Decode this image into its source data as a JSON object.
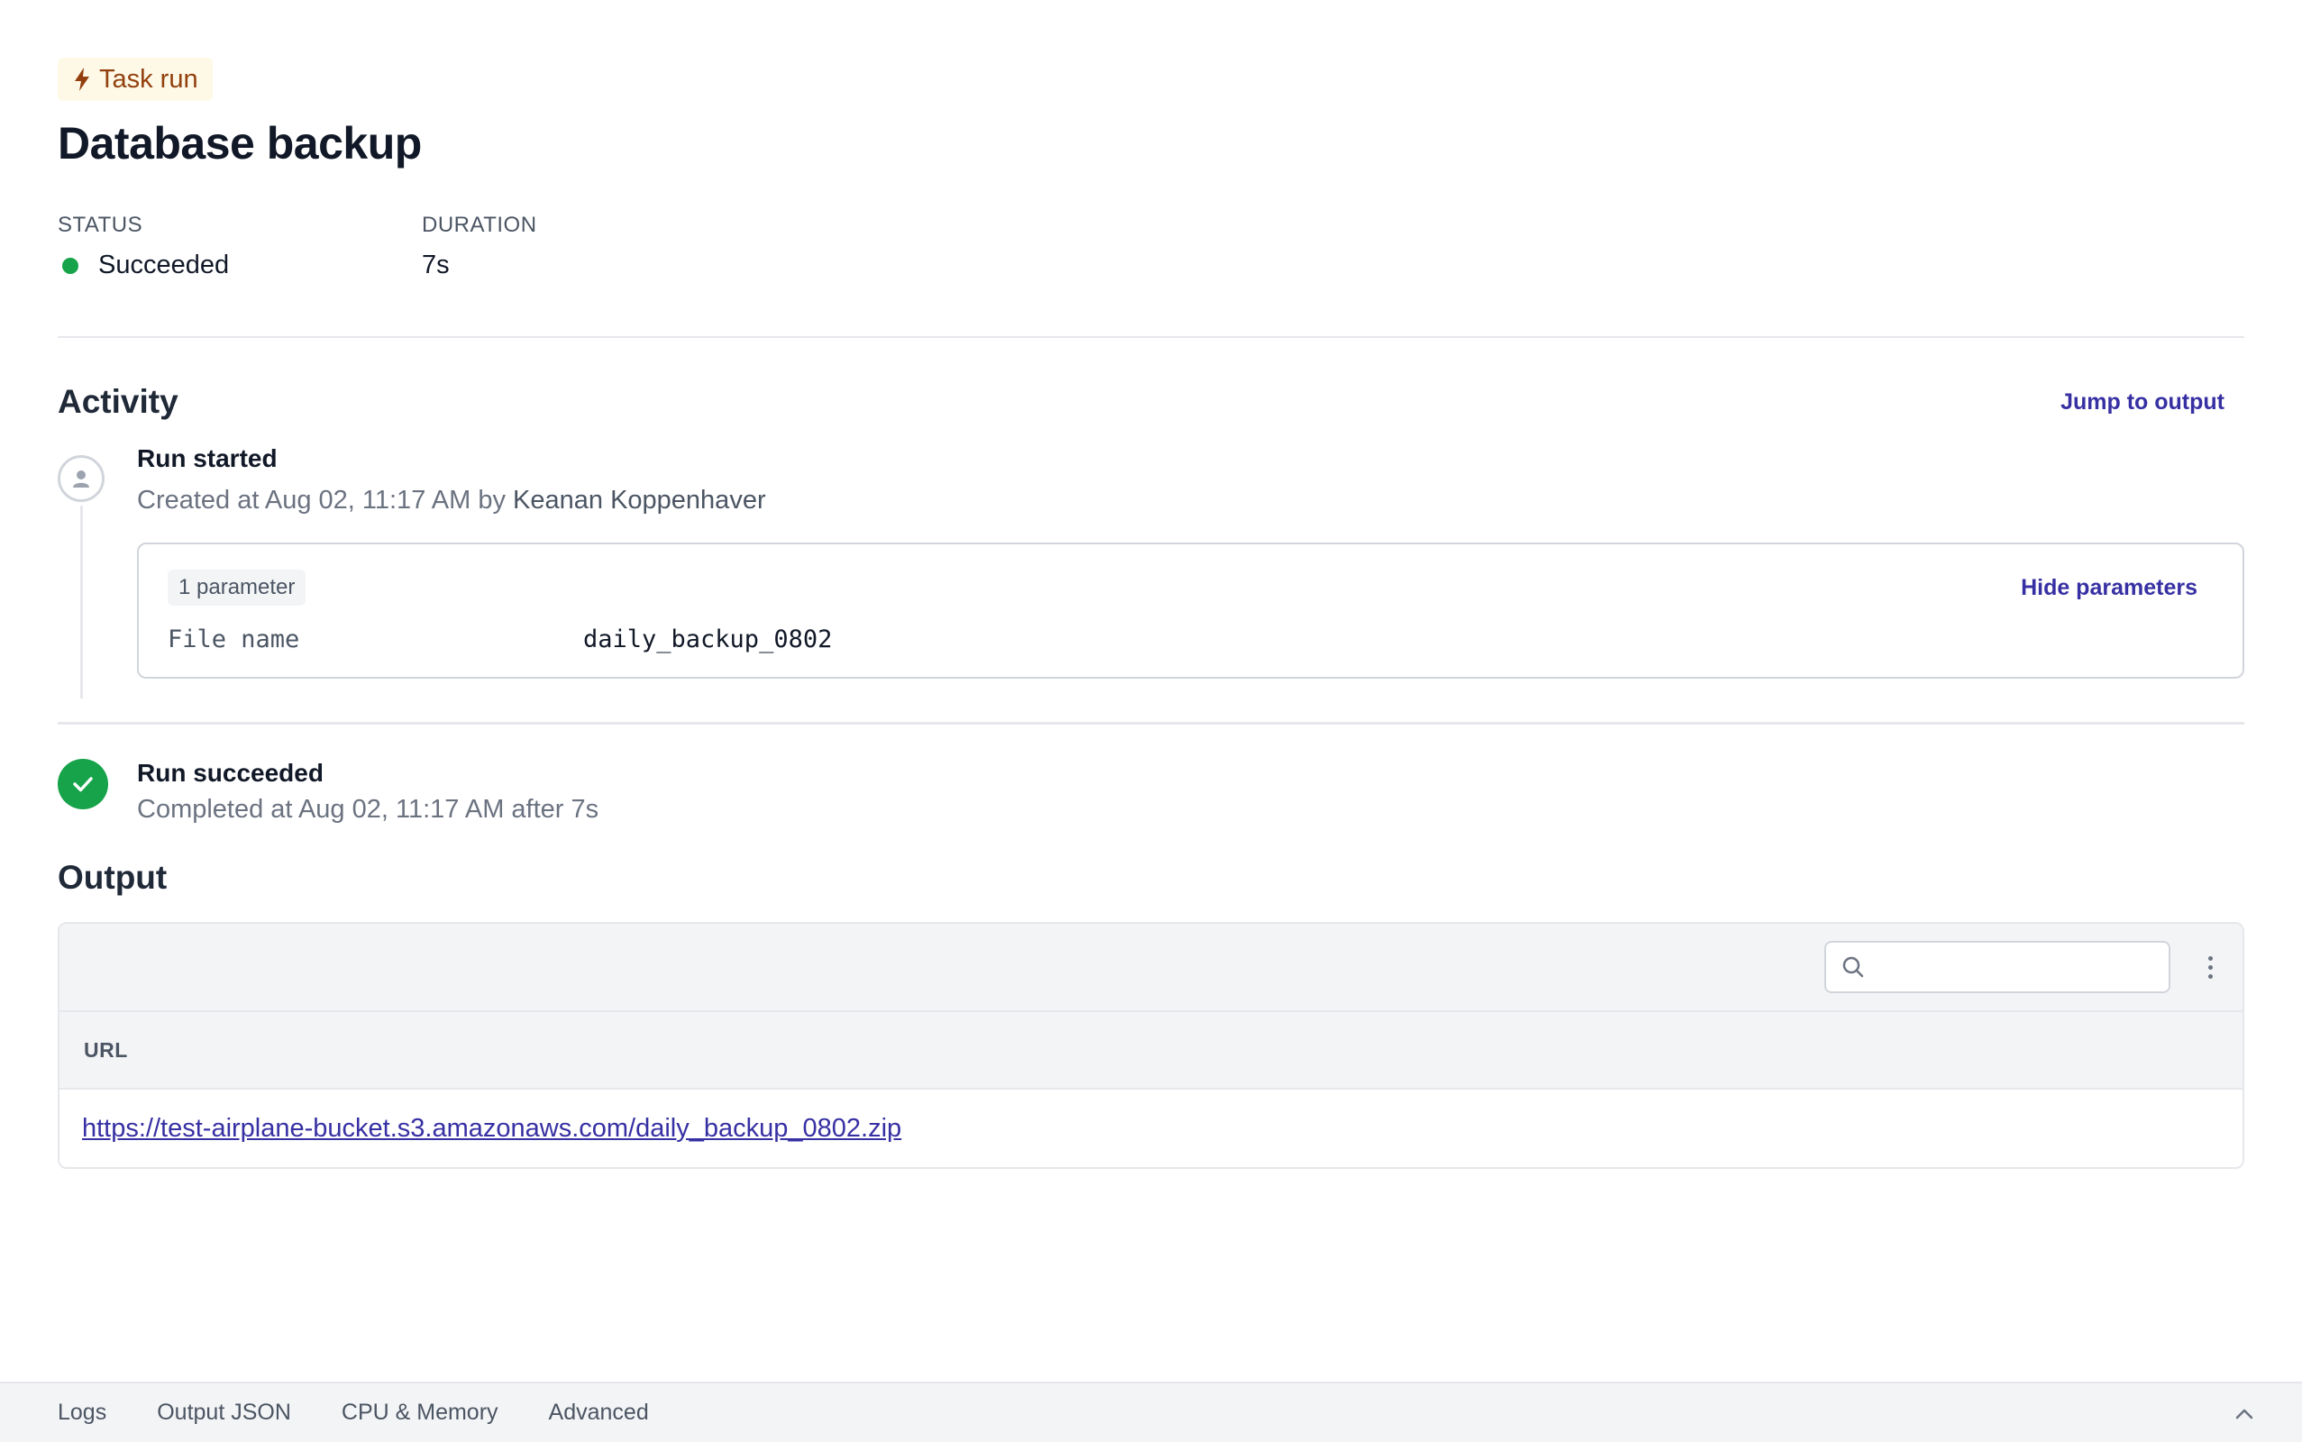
{
  "header": {
    "badge_label": "Task run",
    "badge_icon": "lightning-icon",
    "title": "Database backup"
  },
  "meta": {
    "status_label": "STATUS",
    "status_value": "Succeeded",
    "status_color": "#16a34a",
    "duration_label": "DURATION",
    "duration_value": "7s"
  },
  "activity": {
    "title": "Activity",
    "jump_label": "Jump to output",
    "started": {
      "title": "Run started",
      "sub_prefix": "Created at Aug 02, 11:17 AM by ",
      "user": "Keanan Koppenhaver",
      "params": {
        "count_label": "1 parameter",
        "toggle_label": "Hide parameters",
        "rows": [
          {
            "key": "File name",
            "value": "daily_backup_0802"
          }
        ]
      }
    },
    "succeeded": {
      "title": "Run succeeded",
      "sub": "Completed at Aug 02, 11:17 AM after 7s"
    }
  },
  "output": {
    "title": "Output",
    "search_placeholder": "",
    "columns": [
      "URL"
    ],
    "rows": [
      [
        "https://test-airplane-bucket.s3.amazonaws.com/daily_backup_0802.zip"
      ]
    ]
  },
  "bottom_tabs": [
    "Logs",
    "Output JSON",
    "CPU & Memory",
    "Advanced"
  ],
  "colors": {
    "accent": "#3730a3",
    "success": "#16a34a",
    "badge_bg": "#fef9e7",
    "badge_text": "#92400e"
  }
}
